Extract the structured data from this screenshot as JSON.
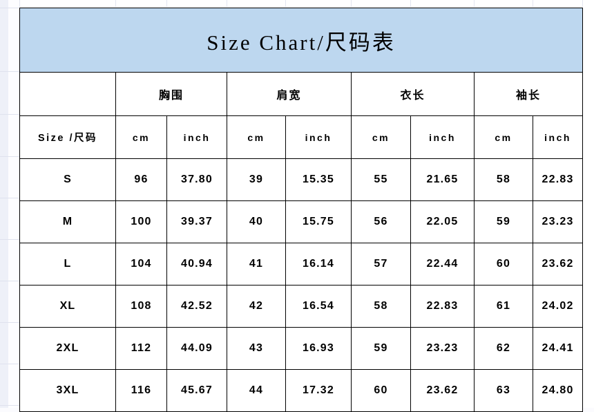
{
  "title": "Size Chart/尺码表",
  "theme": {
    "title_background": "#bdd7ef",
    "border_color": "#000000",
    "cell_background": "#ffffff",
    "text_color": "#000000"
  },
  "table": {
    "size_column_header": "Size /尺码",
    "measurements": [
      {
        "name": "胸围",
        "units": [
          "cm",
          "inch"
        ]
      },
      {
        "name": "肩宽",
        "units": [
          "cm",
          "inch"
        ]
      },
      {
        "name": "衣长",
        "units": [
          "cm",
          "inch"
        ]
      },
      {
        "name": "袖长",
        "units": [
          "cm",
          "inch"
        ]
      }
    ],
    "unit_labels": {
      "cm": "cm",
      "inch": "inch"
    },
    "rows": [
      {
        "size": "S",
        "chest_cm": "96",
        "chest_inch": "37.80",
        "shoulder_cm": "39",
        "shoulder_inch": "15.35",
        "length_cm": "55",
        "length_inch": "21.65",
        "sleeve_cm": "58",
        "sleeve_inch": "22.83"
      },
      {
        "size": "M",
        "chest_cm": "100",
        "chest_inch": "39.37",
        "shoulder_cm": "40",
        "shoulder_inch": "15.75",
        "length_cm": "56",
        "length_inch": "22.05",
        "sleeve_cm": "59",
        "sleeve_inch": "23.23"
      },
      {
        "size": "L",
        "chest_cm": "104",
        "chest_inch": "40.94",
        "shoulder_cm": "41",
        "shoulder_inch": "16.14",
        "length_cm": "57",
        "length_inch": "22.44",
        "sleeve_cm": "60",
        "sleeve_inch": "23.62"
      },
      {
        "size": "XL",
        "chest_cm": "108",
        "chest_inch": "42.52",
        "shoulder_cm": "42",
        "shoulder_inch": "16.54",
        "length_cm": "58",
        "length_inch": "22.83",
        "sleeve_cm": "61",
        "sleeve_inch": "24.02"
      },
      {
        "size": "2XL",
        "chest_cm": "112",
        "chest_inch": "44.09",
        "shoulder_cm": "43",
        "shoulder_inch": "16.93",
        "length_cm": "59",
        "length_inch": "23.23",
        "sleeve_cm": "62",
        "sleeve_inch": "24.41"
      },
      {
        "size": "3XL",
        "chest_cm": "116",
        "chest_inch": "45.67",
        "shoulder_cm": "44",
        "shoulder_inch": "17.32",
        "length_cm": "60",
        "length_inch": "23.62",
        "sleeve_cm": "63",
        "sleeve_inch": "24.80"
      }
    ]
  }
}
